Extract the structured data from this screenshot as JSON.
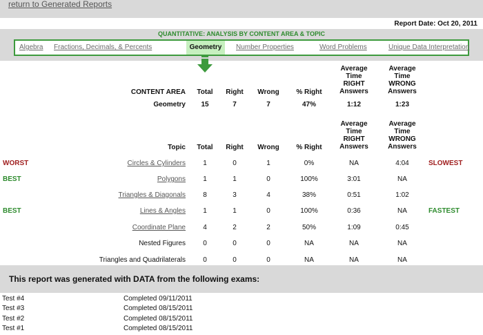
{
  "header": {
    "return_link": "return to Generated Reports",
    "report_date": "Report Date: Oct 20, 2011"
  },
  "nav": {
    "title": "QUANTITATIVE: ANALYSIS BY CONTENT AREA & TOPIC",
    "tabs": [
      "Algebra",
      "Fractions, Decimals, & Percents",
      "Geometry",
      "Number Properties",
      "Word Problems",
      "Unique Data Interpretation"
    ],
    "active_tab": "Geometry"
  },
  "summary": {
    "headers": {
      "content_area": "CONTENT AREA",
      "total": "Total",
      "right": "Right",
      "wrong": "Wrong",
      "pct_right": "% Right",
      "avg_right": "Average Time RIGHT Answers",
      "avg_wrong": "Average Time WRONG Answers"
    },
    "row": {
      "content_area": "Geometry",
      "total": "15",
      "right": "7",
      "wrong": "7",
      "pct_right": "47%",
      "avg_right": "1:12",
      "avg_wrong": "1:23"
    }
  },
  "topics": {
    "headers": {
      "topic": "Topic",
      "total": "Total",
      "right": "Right",
      "wrong": "Wrong",
      "pct_right": "% Right",
      "avg_right": "Average Time RIGHT Answers",
      "avg_wrong": "Average Time WRONG Answers"
    },
    "rows": [
      {
        "tag": "WORST",
        "topic": "Circles & Cylinders",
        "total": "1",
        "right": "0",
        "wrong": "1",
        "pct_right": "0%",
        "avg_right": "NA",
        "avg_wrong": "4:04",
        "speed": "SLOWEST"
      },
      {
        "tag": "BEST",
        "topic": "Polygons",
        "total": "1",
        "right": "1",
        "wrong": "0",
        "pct_right": "100%",
        "avg_right": "3:01",
        "avg_wrong": "NA",
        "speed": ""
      },
      {
        "tag": "",
        "topic": "Triangles & Diagonals",
        "total": "8",
        "right": "3",
        "wrong": "4",
        "pct_right": "38%",
        "avg_right": "0:51",
        "avg_wrong": "1:02",
        "speed": ""
      },
      {
        "tag": "BEST",
        "topic": "Lines & Angles",
        "total": "1",
        "right": "1",
        "wrong": "0",
        "pct_right": "100%",
        "avg_right": "0:36",
        "avg_wrong": "NA",
        "speed": "FASTEST"
      },
      {
        "tag": "",
        "topic": "Coordinate Plane",
        "total": "4",
        "right": "2",
        "wrong": "2",
        "pct_right": "50%",
        "avg_right": "1:09",
        "avg_wrong": "0:45",
        "speed": ""
      },
      {
        "tag": "",
        "topic": "Nested Figures",
        "total": "0",
        "right": "0",
        "wrong": "0",
        "pct_right": "NA",
        "avg_right": "NA",
        "avg_wrong": "NA",
        "speed": ""
      },
      {
        "tag": "",
        "topic": "Triangles and Quadrilaterals",
        "total": "0",
        "right": "0",
        "wrong": "0",
        "pct_right": "NA",
        "avg_right": "NA",
        "avg_wrong": "NA",
        "speed": ""
      }
    ]
  },
  "footer": {
    "banner": "This report was generated with DATA from the following exams:",
    "exams": [
      {
        "test": "Test #4",
        "status": "Completed 09/11/2011"
      },
      {
        "test": "Test #3",
        "status": "Completed 08/15/2011"
      },
      {
        "test": "Test #2",
        "status": "Completed 08/15/2011"
      },
      {
        "test": "Test #1",
        "status": "Completed 08/15/2011"
      }
    ]
  },
  "colors": {
    "green": "#2e8b2e",
    "red": "#a02020",
    "nav_bg": "#d9d9d9",
    "active_tab_bg": "#c6f0bf"
  }
}
